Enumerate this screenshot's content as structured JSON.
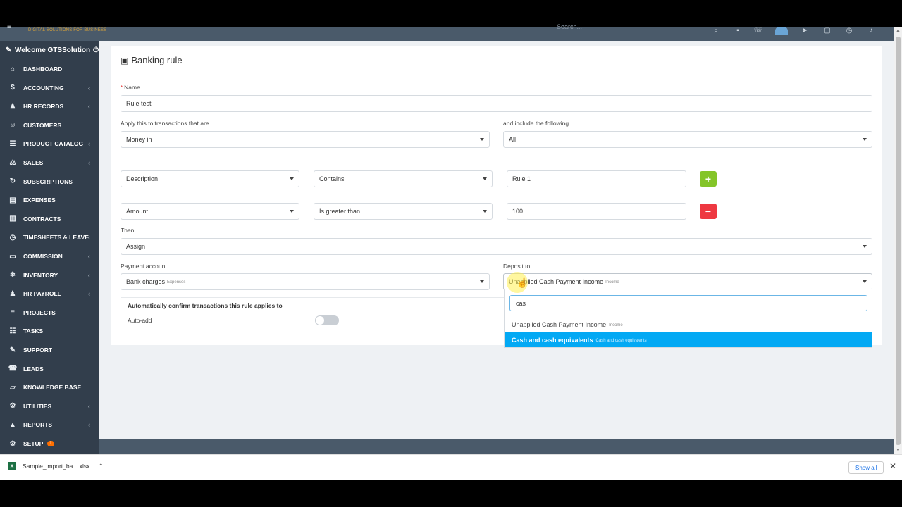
{
  "header": {
    "logo_tagline": "DIGITAL SOLUTIONS FOR BUSINESS",
    "search_placeholder": "Search..."
  },
  "sidebar": {
    "welcome": "Welcome GTSSolution",
    "items": [
      {
        "label": "DASHBOARD",
        "icon": "home-icon",
        "chevron": false
      },
      {
        "label": "ACCOUNTING",
        "icon": "dollar-icon",
        "chevron": true
      },
      {
        "label": "HR RECORDS",
        "icon": "users-icon",
        "chevron": true
      },
      {
        "label": "CUSTOMERS",
        "icon": "user-icon",
        "chevron": false
      },
      {
        "label": "PRODUCT CATALOG",
        "icon": "list-icon",
        "chevron": true
      },
      {
        "label": "SALES",
        "icon": "scale-icon",
        "chevron": true
      },
      {
        "label": "SUBSCRIPTIONS",
        "icon": "refresh-icon",
        "chevron": false
      },
      {
        "label": "EXPENSES",
        "icon": "file-icon",
        "chevron": false
      },
      {
        "label": "CONTRACTS",
        "icon": "document-icon",
        "chevron": false
      },
      {
        "label": "TIMESHEETS & LEAVE",
        "icon": "clock-icon",
        "chevron": true
      },
      {
        "label": "COMMISSION",
        "icon": "money-icon",
        "chevron": true
      },
      {
        "label": "INVENTORY",
        "icon": "snowflake-icon",
        "chevron": true
      },
      {
        "label": "HR PAYROLL",
        "icon": "group-icon",
        "chevron": true
      },
      {
        "label": "PROJECTS",
        "icon": "bars-icon",
        "chevron": false
      },
      {
        "label": "TASKS",
        "icon": "tasks-icon",
        "chevron": false
      },
      {
        "label": "SUPPORT",
        "icon": "tag-icon",
        "chevron": false
      },
      {
        "label": "LEADS",
        "icon": "tty-icon",
        "chevron": false
      },
      {
        "label": "KNOWLEDGE BASE",
        "icon": "folder-icon",
        "chevron": false
      },
      {
        "label": "UTILITIES",
        "icon": "cogs-icon",
        "chevron": true
      },
      {
        "label": "REPORTS",
        "icon": "chart-icon",
        "chevron": true
      },
      {
        "label": "SETUP",
        "icon": "gear-icon",
        "chevron": false,
        "badge": "1"
      }
    ]
  },
  "form": {
    "title": "Banking rule",
    "name_label": "Name",
    "name_value": "Rule test",
    "apply_label": "Apply this to transactions that are",
    "apply_value": "Money in",
    "include_label": "and include the following",
    "include_value": "All",
    "conditions": [
      {
        "field": "Description",
        "operator": "Contains",
        "value": "Rule 1",
        "action": "+"
      },
      {
        "field": "Amount",
        "operator": "Is greater than",
        "value": "100",
        "action": "−"
      }
    ],
    "then_label": "Then",
    "then_value": "Assign",
    "payment_label": "Payment account",
    "payment_value": "Bank charges",
    "payment_sub": "Expenses",
    "deposit_label": "Deposit to",
    "deposit_value": "Unapplied Cash Payment Income",
    "deposit_sub": "Income",
    "auto_title": "Automatically confirm transactions this rule applies to",
    "autoadd_label": "Auto-add",
    "autoadd_on": false
  },
  "dropdown": {
    "search_value": "cas",
    "options": [
      {
        "label": "Unapplied Cash Payment Income",
        "sub": "Income",
        "highlighted": false
      },
      {
        "label": "Cash and cash equivalents",
        "sub": "Cash and cash equivalents",
        "highlighted": true
      }
    ]
  },
  "downloads": {
    "file_name": "Sample_import_ba....xlsx",
    "show_all": "Show all"
  },
  "colors": {
    "sidebar_bg": "#323e4c",
    "add_button": "#84c529",
    "remove_button": "#ee3841",
    "highlight": "#03a9f4"
  }
}
